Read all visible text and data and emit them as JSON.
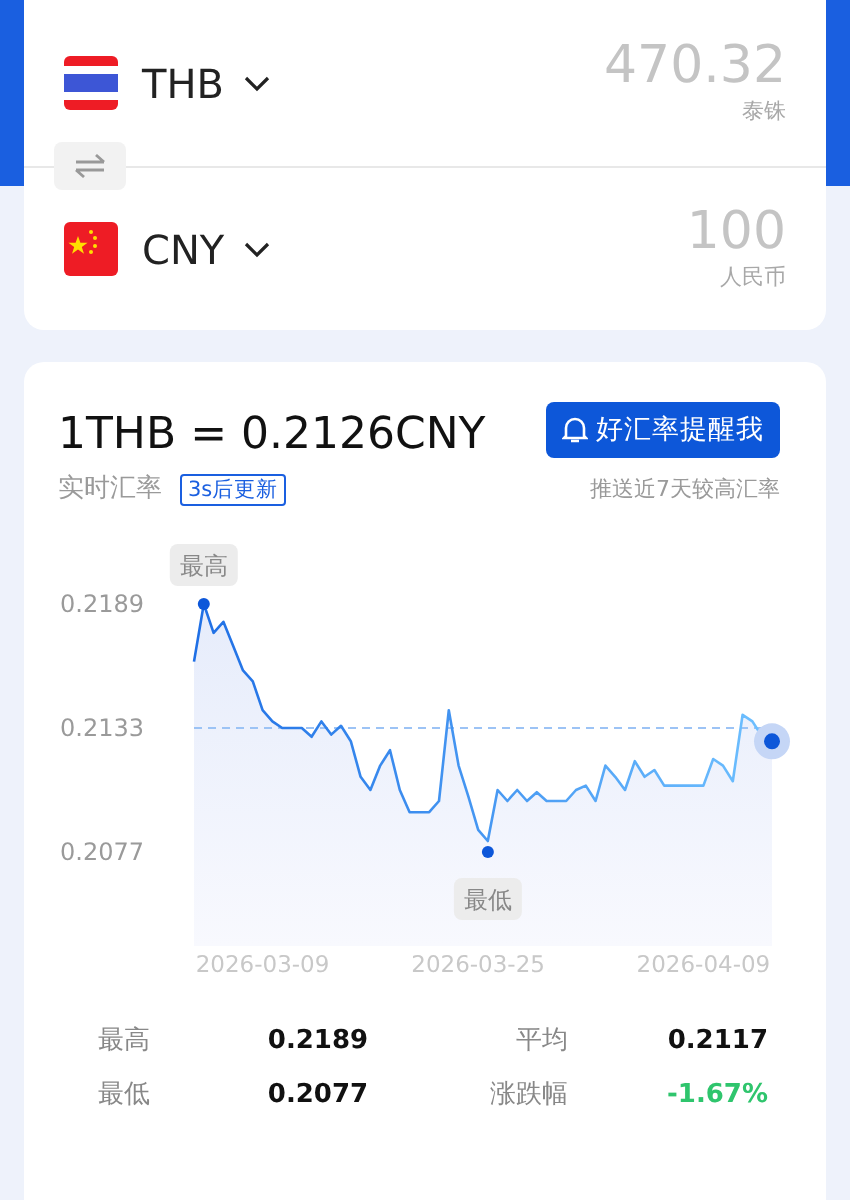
{
  "converter": {
    "rows": [
      {
        "kind": "th",
        "code": "THB",
        "amount": "470.32",
        "name": "泰铢"
      },
      {
        "kind": "cn",
        "code": "CNY",
        "amount": "100",
        "name": "人民币"
      }
    ]
  },
  "rate": {
    "title": "1THB = 0.2126CNY",
    "subtitle": "实时汇率",
    "refresh_badge": "3s后更新",
    "alert_button": "好汇率提醒我",
    "alert_note": "推送近7天较高汇率",
    "chart_data": {
      "type": "area",
      "ylim": [
        0.2077,
        0.2189
      ],
      "yticks": [
        0.2077,
        0.2133,
        0.2189
      ],
      "categories": [
        null,
        null,
        null,
        null,
        null,
        null,
        null,
        "2026-03-09",
        null,
        null,
        null,
        null,
        null,
        null,
        null,
        null,
        null,
        null,
        null,
        null,
        null,
        null,
        null,
        null,
        null,
        null,
        null,
        null,
        null,
        "2026-03-25",
        null,
        null,
        null,
        null,
        null,
        null,
        null,
        null,
        null,
        null,
        null,
        null,
        null,
        null,
        null,
        null,
        null,
        null,
        null,
        null,
        null,
        null,
        "2026-04-09",
        null,
        null,
        null,
        null,
        null,
        null,
        null
      ],
      "series": [
        {
          "color": "#1f6fe5",
          "values": [
            0.2163,
            0.2189,
            0.2176,
            0.2181,
            0.217,
            0.2159,
            0.2154,
            0.2141,
            0.2136,
            0.2133,
            0.2133,
            0.2133,
            0.2129,
            0.2136,
            0.213,
            0.2134,
            0.2127,
            0.2111,
            0.2105,
            0.2116,
            0.2123,
            0.2105,
            0.2095,
            0.2095,
            0.2095,
            0.21,
            0.2141,
            0.2116,
            0.2102,
            0.2087,
            0.2082,
            0.2105,
            0.21,
            0.2105,
            0.21,
            0.2104,
            0.21,
            0.21,
            0.21,
            0.2105,
            0.2107,
            0.21,
            0.2116,
            0.2111,
            0.2105,
            0.2118,
            0.2111,
            0.2114,
            0.2107,
            0.2107,
            0.2107,
            0.2107,
            0.2107,
            0.2119,
            0.2116,
            0.2109,
            0.2139,
            0.2136,
            0.2129,
            0.2127
          ]
        }
      ],
      "ref_lines": [
        {
          "axis": "y",
          "value": 0.2133
        }
      ],
      "annotations": [
        {
          "text": "最高",
          "y": 0.2189
        },
        {
          "text": "最低",
          "y": 0.2077
        }
      ]
    }
  },
  "stats": [
    {
      "label": "最高",
      "value": "0.2189",
      "negative": false
    },
    {
      "label": "平均",
      "value": "0.2117",
      "negative": false
    },
    {
      "label": "最低",
      "value": "0.2077",
      "negative": false
    },
    {
      "label": "涨跌幅",
      "value": "-1.67%",
      "negative": true
    }
  ]
}
